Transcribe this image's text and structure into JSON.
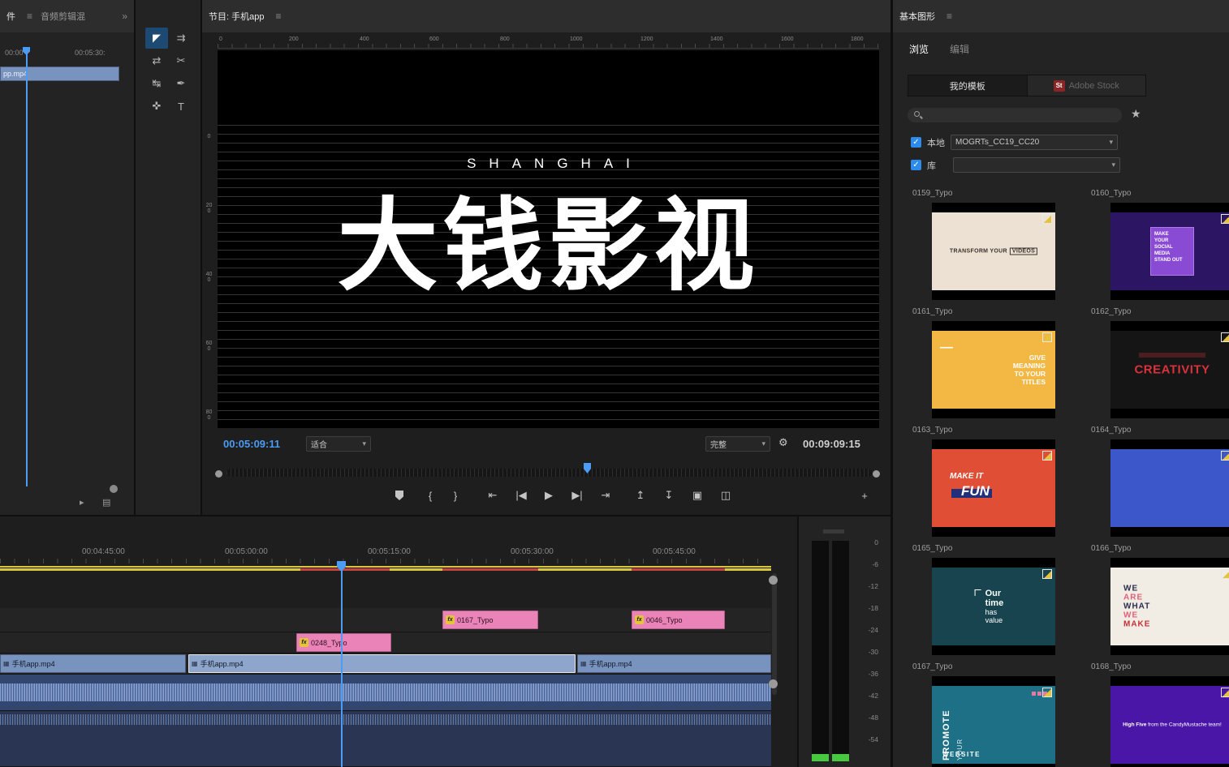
{
  "colors": {
    "accent": "#2d8ceb",
    "timecode_blue": "#4a9cf5",
    "playhead_blue": "#4a9cf5",
    "clip_pink": "#ea83b8",
    "clip_blue": "#7993bf",
    "clip_blue_sel": "#8ea6cc",
    "fx_yellow": "#e5c43b",
    "render_yellow": "#d9c63f",
    "render_red": "#c8413c",
    "meter_green": "#47c93f",
    "stock_red": "#8c2626",
    "t159_bg": "#ece1d3",
    "t160_bg": "#2c1563",
    "t160_box": "#8a4bd4",
    "t161_bg": "#f2b843",
    "t162_bg": "#151515",
    "t162_red": "#d8323c",
    "t163_bg": "#e04f35",
    "t163_bar": "#20307a",
    "t164_bg": "#3c57c9",
    "t165_bg": "#17444e",
    "t166_bg": "#f1ece4",
    "t166_navy": "#2a2d4e",
    "t166_pink": "#e0607a",
    "t166_red": "#c4303a",
    "t167_bg": "#1d7086",
    "t167_pink": "#e878a0",
    "t168_bg": "#4a16a8"
  },
  "icons": {
    "menu": "≡",
    "overflow": "»",
    "chevron_down": "▾",
    "check": "✓",
    "star": "★",
    "wrench": "⚙",
    "note": "▸",
    "doc": "▤",
    "film": "▦",
    "fx": "fx"
  },
  "left_panel": {
    "tab_cut": "件",
    "tab_audio_mixer": "音频剪辑混",
    "time_start": "00:00",
    "time_end": "00:05:30:",
    "clip_label": "pp.mp4"
  },
  "tools": {
    "items": [
      {
        "name": "selection-tool",
        "glyph": "◤"
      },
      {
        "name": "track-select-forward-tool",
        "glyph": "⇉"
      },
      {
        "name": "ripple-edit-tool",
        "glyph": "⇄"
      },
      {
        "name": "razor-tool",
        "glyph": "✂"
      },
      {
        "name": "slip-tool",
        "glyph": "↹"
      },
      {
        "name": "pen-tool",
        "glyph": "✒"
      },
      {
        "name": "hand-tool",
        "glyph": "✜"
      },
      {
        "name": "type-tool",
        "glyph": "T"
      }
    ]
  },
  "monitor": {
    "title": "节目: 手机app",
    "h_ruler": [
      "0",
      "200",
      "400",
      "600",
      "800",
      "1000",
      "1200",
      "1400",
      "1600",
      "1800"
    ],
    "v_ruler": [
      "0",
      "200",
      "400",
      "600",
      "800"
    ],
    "overlay_subtitle": "SHANGHAI",
    "overlay_title": "大钱影视",
    "current_time": "00:05:09:11",
    "zoom_select": "适合",
    "quality_select": "完整",
    "duration": "00:09:09:15"
  },
  "transport": {
    "mark_in": "{",
    "mark_out": "}",
    "go_in": "⇤",
    "step_back": "|◀",
    "play": "▶",
    "step_fwd": "▶|",
    "go_out": "⇥",
    "lift": "↥",
    "extract": "↧",
    "export_frame": "▣",
    "compare": "◫",
    "add": "+"
  },
  "timeline": {
    "ruler": [
      "00:04:45:00",
      "00:05:00:00",
      "00:05:15:00",
      "00:05:30:00",
      "00:05:45:00"
    ],
    "v3_clips": [
      {
        "label": "0167_Typo"
      },
      {
        "label": "0046_Typo"
      }
    ],
    "v2_clips": [
      {
        "label": "0248_Typo"
      }
    ],
    "v1_clips": [
      {
        "label": "手机app.mp4"
      },
      {
        "label": "手机app.mp4"
      },
      {
        "label": "手机app.mp4"
      }
    ]
  },
  "meters": {
    "scale": [
      "0",
      "-6",
      "-12",
      "-18",
      "-24",
      "-30",
      "-36",
      "-42",
      "-48",
      "-54"
    ]
  },
  "eg": {
    "title": "基本图形",
    "tab_browse": "浏览",
    "tab_edit": "编辑",
    "btn_my_templates": "我的模板",
    "btn_adobe_stock": "Adobe Stock",
    "stock_logo": "St",
    "chk_local": "本地",
    "chk_library": "库",
    "local_value": "MOGRTs_CC19_CC20",
    "templates": [
      {
        "name": "0159_Typo",
        "line1": "TRANSFORM YOUR",
        "line2": "VIDEOS"
      },
      {
        "name": "0160_Typo",
        "text": "MAKE\nYOUR\nSOCIAL\nMEDIA\nSTAND OUT"
      },
      {
        "name": "0161_Typo",
        "dash": "—",
        "text": "GIVE\nMEANING\nTO YOUR\nTITLES"
      },
      {
        "name": "0162_Typo",
        "text": "CREATIVITY"
      },
      {
        "name": "0163_Typo",
        "line1": "MAKE IT",
        "line2": "FUN"
      },
      {
        "name": "0164_Typo"
      },
      {
        "name": "0165_Typo",
        "words": [
          "Our",
          "time",
          "has",
          "value"
        ]
      },
      {
        "name": "0166_Typo",
        "words": [
          "WE",
          "ARE",
          "WHAT",
          "WE",
          "MAKE"
        ]
      },
      {
        "name": "0167_Typo",
        "vert1": "PROMOTE",
        "vert2": "YOUR",
        "bottom": "WEBSITE"
      },
      {
        "name": "0168_Typo",
        "bold": "High Five",
        "rest": " from the CandyMustache team!"
      }
    ]
  }
}
